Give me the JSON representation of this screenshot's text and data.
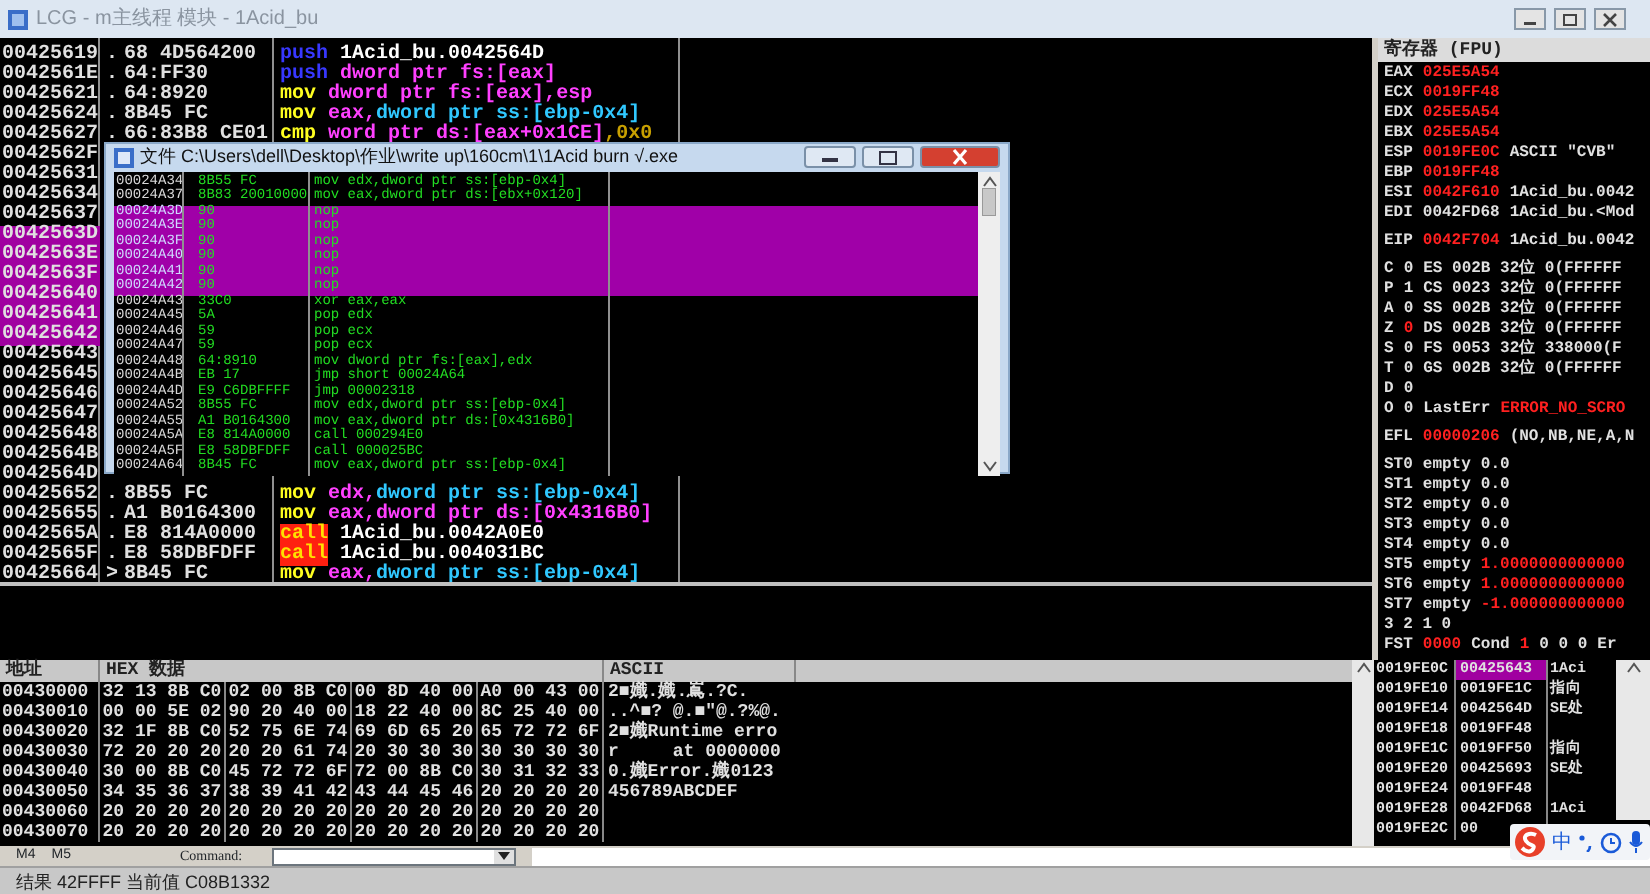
{
  "window": {
    "title": "LCG - m主线程 模块 - 1Acid_bu"
  },
  "disassembly": {
    "rows": [
      {
        "address": "00425619",
        "selected": false,
        "marker": ".",
        "hex": "68 4D564200",
        "op": "push",
        "kind": "stackop",
        "args": [
          {
            "text": "1Acid_bu.0042564D",
            "kind": "label"
          }
        ]
      },
      {
        "address": "0042561E",
        "selected": false,
        "marker": ".",
        "hex": "64:FF30",
        "op": "push",
        "kind": "stackop",
        "args": [
          {
            "text": "dword ptr fs:[eax]",
            "kind": "mem"
          }
        ]
      },
      {
        "address": "00425621",
        "selected": false,
        "marker": ".",
        "hex": "64:8920",
        "op": "mov",
        "kind": "dataop",
        "args": [
          {
            "text": "dword ptr fs:[eax]",
            "kind": "mem"
          },
          {
            "text": ",esp",
            "kind": "reg"
          }
        ]
      },
      {
        "address": "00425624",
        "selected": false,
        "marker": ".",
        "hex": "8B45 FC",
        "op": "mov",
        "kind": "dataop",
        "args": [
          {
            "text": "eax,",
            "kind": "reg"
          },
          {
            "text": "dword ptr ss:[ebp-0x4]",
            "kind": "stack"
          }
        ]
      },
      {
        "address": "00425627",
        "selected": false,
        "marker": ".",
        "hex": "66:83B8 CE01",
        "op": "cmp",
        "kind": "dataop",
        "args": [
          {
            "text": "word ptr ds:[eax+0x1CE]",
            "kind": "mem"
          },
          {
            "text": ",0x0",
            "kind": "imm"
          }
        ]
      },
      {
        "address": "0042562F",
        "selected": false
      },
      {
        "address": "00425631",
        "selected": false
      },
      {
        "address": "00425634",
        "selected": false
      },
      {
        "address": "00425637",
        "selected": false
      },
      {
        "address": "0042563D",
        "selected": true
      },
      {
        "address": "0042563E",
        "selected": true
      },
      {
        "address": "0042563F",
        "selected": true
      },
      {
        "address": "00425640",
        "selected": true
      },
      {
        "address": "00425641",
        "selected": true
      },
      {
        "address": "00425642",
        "selected": true
      },
      {
        "address": "00425643",
        "selected": false
      },
      {
        "address": "00425645",
        "selected": false
      },
      {
        "address": "00425646",
        "selected": false
      },
      {
        "address": "00425647",
        "selected": false
      },
      {
        "address": "00425648",
        "selected": false
      },
      {
        "address": "0042564B",
        "selected": false
      },
      {
        "address": "0042564D",
        "selected": false
      },
      {
        "address": "00425652",
        "selected": false,
        "marker": ".",
        "hex": "8B55 FC",
        "op": "mov",
        "kind": "dataop",
        "args": [
          {
            "text": "edx,",
            "kind": "reg"
          },
          {
            "text": "dword ptr ss:[ebp-0x4]",
            "kind": "stack"
          }
        ]
      },
      {
        "address": "00425655",
        "selected": false,
        "marker": ".",
        "hex": "A1 B0164300",
        "op": "mov",
        "kind": "dataop",
        "args": [
          {
            "text": "eax,",
            "kind": "reg"
          },
          {
            "text": "dword ptr ds:[0x4316B0]",
            "kind": "mem"
          }
        ]
      },
      {
        "address": "0042565A",
        "selected": false,
        "marker": ".",
        "hex": "E8 814A0000",
        "op": "call",
        "kind": "branchop",
        "args": [
          {
            "text": "1Acid_bu.0042A0E0",
            "kind": "label"
          }
        ]
      },
      {
        "address": "0042565F",
        "selected": false,
        "marker": ".",
        "hex": "E8 58DBFDFF",
        "op": "call",
        "kind": "branchop",
        "args": [
          {
            "text": "1Acid_bu.004031BC",
            "kind": "label"
          }
        ]
      },
      {
        "address": "00425664",
        "selected": false,
        "marker": ">",
        "hex": "8B45 FC",
        "op": "mov",
        "kind": "dataop",
        "args": [
          {
            "text": "eax,",
            "kind": "reg"
          },
          {
            "text": "dword ptr ss:[ebp-0x4]",
            "kind": "stack"
          }
        ]
      }
    ]
  },
  "file_window": {
    "title": "文件 C:\\Users\\dell\\Desktop\\作业\\write up\\160cm\\1\\1Acid burn  √.exe",
    "rows": [
      {
        "address": "00024A34",
        "hex": "8B55 FC",
        "code": "mov edx,dword ptr ss:[ebp-0x4]",
        "selected": false
      },
      {
        "address": "00024A37",
        "hex": "8B83 20010000",
        "code": "mov eax,dword ptr ds:[ebx+0x120]",
        "selected": false
      },
      {
        "address": "00024A3D",
        "hex": "90",
        "code": "nop",
        "selected": true
      },
      {
        "address": "00024A3E",
        "hex": "90",
        "code": "nop",
        "selected": true
      },
      {
        "address": "00024A3F",
        "hex": "90",
        "code": "nop",
        "selected": true
      },
      {
        "address": "00024A40",
        "hex": "90",
        "code": "nop",
        "selected": true
      },
      {
        "address": "00024A41",
        "hex": "90",
        "code": "nop",
        "selected": true
      },
      {
        "address": "00024A42",
        "hex": "90",
        "code": "nop",
        "selected": true
      },
      {
        "address": "00024A43",
        "hex": "33C0",
        "code": "xor eax,eax",
        "selected": false
      },
      {
        "address": "00024A45",
        "hex": "5A",
        "code": "pop edx",
        "selected": false
      },
      {
        "address": "00024A46",
        "hex": "59",
        "code": "pop ecx",
        "selected": false
      },
      {
        "address": "00024A47",
        "hex": "59",
        "code": "pop ecx",
        "selected": false
      },
      {
        "address": "00024A48",
        "hex": "64:8910",
        "code": "mov dword ptr fs:[eax],edx",
        "selected": false
      },
      {
        "address": "00024A4B",
        "hex": "EB 17",
        "code": "jmp short 00024A64",
        "selected": false
      },
      {
        "address": "00024A4D",
        "hex": "E9 C6DBFFFF",
        "code": "jmp 00002318",
        "selected": false
      },
      {
        "address": "00024A52",
        "hex": "8B55 FC",
        "code": "mov edx,dword ptr ss:[ebp-0x4]",
        "selected": false
      },
      {
        "address": "00024A55",
        "hex": "A1 B0164300",
        "code": "mov eax,dword ptr ds:[0x4316B0]",
        "selected": false
      },
      {
        "address": "00024A5A",
        "hex": "E8 814A0000",
        "code": "call 000294E0",
        "selected": false
      },
      {
        "address": "00024A5F",
        "hex": "E8 58DBFDFF",
        "code": "call 000025BC",
        "selected": false
      },
      {
        "address": "00024A64",
        "hex": "8B45 FC",
        "code": "mov eax,dword ptr ss:[ebp-0x4]",
        "selected": false
      }
    ]
  },
  "registers": {
    "title": "寄存器 (FPU)",
    "groups": [
      [
        {
          "cells": [
            {
              "text": "EAX",
              "changed": false
            },
            {
              "text": "025E5A54",
              "changed": true
            }
          ]
        },
        {
          "cells": [
            {
              "text": "ECX",
              "changed": false
            },
            {
              "text": "0019FF48",
              "changed": true
            }
          ]
        },
        {
          "cells": [
            {
              "text": "EDX",
              "changed": false
            },
            {
              "text": "025E5A54",
              "changed": true
            }
          ]
        },
        {
          "cells": [
            {
              "text": "EBX",
              "changed": false
            },
            {
              "text": "025E5A54",
              "changed": true
            }
          ]
        },
        {
          "cells": [
            {
              "text": "ESP",
              "changed": false
            },
            {
              "text": "0019FE0C",
              "changed": true
            },
            {
              "text": "ASCII \"CVB\"",
              "changed": false
            }
          ]
        },
        {
          "cells": [
            {
              "text": "EBP",
              "changed": false
            },
            {
              "text": "0019FF48",
              "changed": true
            }
          ]
        },
        {
          "cells": [
            {
              "text": "ESI",
              "changed": false
            },
            {
              "text": "0042F610",
              "changed": true
            },
            {
              "text": "1Acid_bu.0042",
              "changed": false
            }
          ]
        },
        {
          "cells": [
            {
              "text": "EDI",
              "changed": false
            },
            {
              "text": "0042FD68",
              "changed": false
            },
            {
              "text": "1Acid_bu.<Mod",
              "changed": false
            }
          ]
        }
      ],
      [
        {
          "cells": [
            {
              "text": "EIP",
              "changed": false
            },
            {
              "text": "0042F704",
              "changed": true
            },
            {
              "text": "1Acid_bu.0042",
              "changed": false
            }
          ]
        }
      ],
      [
        {
          "cells": [
            {
              "text": "C",
              "changed": false
            },
            {
              "text": "0",
              "changed": false
            },
            {
              "text": "ES 002B 32位 0(FFFFFF",
              "changed": false
            }
          ]
        },
        {
          "cells": [
            {
              "text": "P",
              "changed": false
            },
            {
              "text": "1",
              "changed": false
            },
            {
              "text": "CS 0023 32位 0(FFFFFF",
              "changed": false
            }
          ]
        },
        {
          "cells": [
            {
              "text": "A",
              "changed": false
            },
            {
              "text": "0",
              "changed": false
            },
            {
              "text": "SS 002B 32位 0(FFFFFF",
              "changed": false
            }
          ]
        },
        {
          "cells": [
            {
              "text": "Z",
              "changed": false
            },
            {
              "text": "0",
              "changed": true
            },
            {
              "text": "DS 002B 32位 0(FFFFFF",
              "changed": false
            }
          ]
        },
        {
          "cells": [
            {
              "text": "S",
              "changed": false
            },
            {
              "text": "0",
              "changed": false
            },
            {
              "text": "FS 0053 32位 338000(F",
              "changed": false
            }
          ]
        },
        {
          "cells": [
            {
              "text": "T",
              "changed": false
            },
            {
              "text": "0",
              "changed": false
            },
            {
              "text": "GS 002B 32位 0(FFFFFF",
              "changed": false
            }
          ]
        },
        {
          "cells": [
            {
              "text": "D",
              "changed": false
            },
            {
              "text": "0",
              "changed": false
            }
          ]
        },
        {
          "cells": [
            {
              "text": "O",
              "changed": false
            },
            {
              "text": "0",
              "changed": false
            },
            {
              "text": "LastErr",
              "changed": false
            },
            {
              "text": "ERROR_NO_SCRO",
              "changed": true
            }
          ]
        }
      ],
      [
        {
          "cells": [
            {
              "text": "EFL",
              "changed": false
            },
            {
              "text": "00000206",
              "changed": true
            },
            {
              "text": "(NO,NB,NE,A,N",
              "changed": false
            }
          ]
        }
      ],
      [
        {
          "cells": [
            {
              "text": "ST0",
              "changed": false
            },
            {
              "text": "empty",
              "changed": false
            },
            {
              "text": "0.0",
              "changed": false
            }
          ]
        },
        {
          "cells": [
            {
              "text": "ST1",
              "changed": false
            },
            {
              "text": "empty",
              "changed": false
            },
            {
              "text": "0.0",
              "changed": false
            }
          ]
        },
        {
          "cells": [
            {
              "text": "ST2",
              "changed": false
            },
            {
              "text": "empty",
              "changed": false
            },
            {
              "text": "0.0",
              "changed": false
            }
          ]
        },
        {
          "cells": [
            {
              "text": "ST3",
              "changed": false
            },
            {
              "text": "empty",
              "changed": false
            },
            {
              "text": "0.0",
              "changed": false
            }
          ]
        },
        {
          "cells": [
            {
              "text": "ST4",
              "changed": false
            },
            {
              "text": "empty",
              "changed": false
            },
            {
              "text": "0.0",
              "changed": false
            }
          ]
        },
        {
          "cells": [
            {
              "text": "ST5",
              "changed": false
            },
            {
              "text": "empty",
              "changed": false
            },
            {
              "text": "1.0000000000000",
              "changed": true
            }
          ]
        },
        {
          "cells": [
            {
              "text": "ST6",
              "changed": false
            },
            {
              "text": "empty",
              "changed": false
            },
            {
              "text": "1.0000000000000",
              "changed": true
            }
          ]
        },
        {
          "cells": [
            {
              "text": "ST7",
              "changed": false
            },
            {
              "text": "empty",
              "changed": false
            },
            {
              "text": "-1.000000000000",
              "changed": true
            }
          ]
        },
        {
          "cells": [
            {
              "text": "3 2 1 0",
              "changed": false
            }
          ]
        },
        {
          "cells": [
            {
              "text": "FST",
              "changed": false
            },
            {
              "text": "0000",
              "changed": true
            },
            {
              "text": "Cond",
              "changed": false
            },
            {
              "text": "1",
              "changed": true
            },
            {
              "text": "0 0 0",
              "changed": false
            },
            {
              "text": "Er",
              "changed": false
            }
          ]
        }
      ]
    ]
  },
  "dump": {
    "columns": [
      "地址",
      "HEX 数据",
      "ASCII"
    ],
    "rows": [
      {
        "address": "00430000",
        "hex": [
          "32 13 8B C0",
          "02 00 8B C0",
          "00 8D 40 00",
          "A0 00 43 00"
        ],
        "ascii": "2■嬂.嬂.嶌.?C."
      },
      {
        "address": "00430010",
        "hex": [
          "00 00 5E 02",
          "90 20 40 00",
          "18 22 40 00",
          "8C 25 40 00"
        ],
        "ascii": "..^■? @.■\"@.?%@."
      },
      {
        "address": "00430020",
        "hex": [
          "32 1F 8B C0",
          "52 75 6E 74",
          "69 6D 65 20",
          "65 72 72 6F"
        ],
        "ascii": "2■嬂Runtime erro"
      },
      {
        "address": "00430030",
        "hex": [
          "72 20 20 20",
          "20 20 61 74",
          "20 30 30 30",
          "30 30 30 30"
        ],
        "ascii": "r     at 0000000"
      },
      {
        "address": "00430040",
        "hex": [
          "30 00 8B C0",
          "45 72 72 6F",
          "72 00 8B C0",
          "30 31 32 33"
        ],
        "ascii": "0.嬂Error.嬂0123"
      },
      {
        "address": "00430050",
        "hex": [
          "34 35 36 37",
          "38 39 41 42",
          "43 44 45 46",
          "20 20 20 20"
        ],
        "ascii": "456789ABCDEF"
      },
      {
        "address": "00430060",
        "hex": [
          "20 20 20 20",
          "20 20 20 20",
          "20 20 20 20",
          "20 20 20 20"
        ]
      },
      {
        "address": "00430070",
        "hex": [
          "20 20 20 20",
          "20 20 20 20",
          "20 20 20 20",
          "20 20 20 20"
        ]
      }
    ]
  },
  "stack": {
    "rows": [
      {
        "address": "0019FE0C",
        "value": "00425643",
        "comment": "1Aci",
        "selected": true
      },
      {
        "address": "0019FE10",
        "value": "0019FE1C",
        "comment": "指向",
        "selected": false
      },
      {
        "address": "0019FE14",
        "value": "0042564D",
        "comment": "SE处",
        "selected": false
      },
      {
        "address": "0019FE18",
        "value": "0019FF48",
        "selected": false
      },
      {
        "address": "0019FE1C",
        "value": "0019FF50",
        "comment": "指向",
        "selected": false
      },
      {
        "address": "0019FE20",
        "value": "00425693",
        "comment": "SE处",
        "selected": false
      },
      {
        "address": "0019FE24",
        "value": "0019FF48",
        "selected": false
      },
      {
        "address": "0019FE28",
        "value": "0042FD68",
        "comment": "1Aci",
        "selected": false
      },
      {
        "address": "0019FE2C",
        "value": "00",
        "selected": false
      }
    ]
  },
  "command_bar": {
    "tabs": [
      "M4",
      "M5"
    ],
    "label": "Command:"
  },
  "ime_bar": {
    "mode": "中"
  },
  "status_bar": "结果 42FFFF 当前值 C08B1332"
}
